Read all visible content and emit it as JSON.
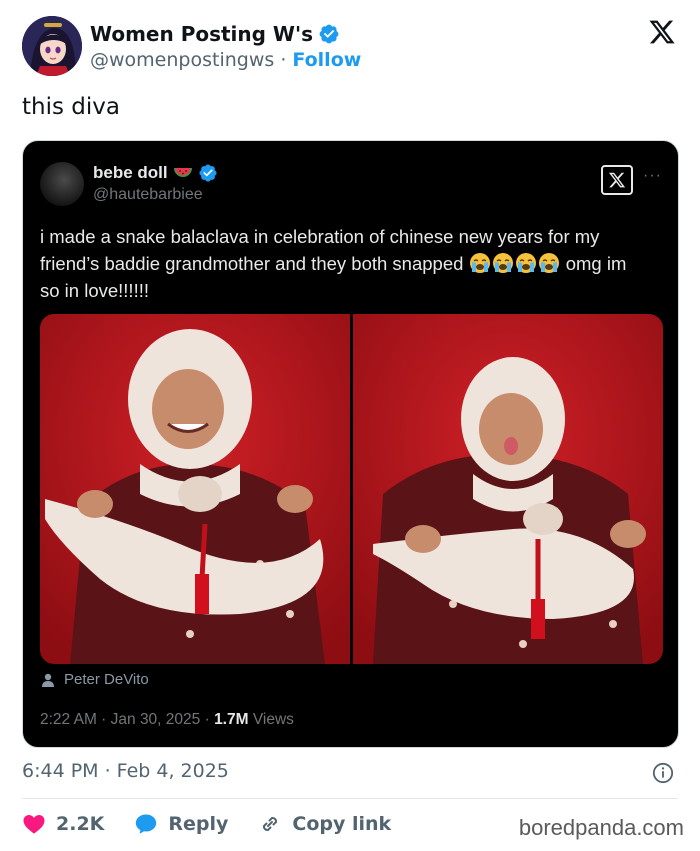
{
  "author": {
    "display_name": "Women Posting W's",
    "handle": "@womenpostingws",
    "separator": "·",
    "follow_label": "Follow"
  },
  "tweet": {
    "text": "this diva",
    "timestamp": "6:44 PM · Feb 4, 2025"
  },
  "quoted": {
    "display_name": "bebe doll",
    "handle": "@hautebarbiee",
    "more_label": "···",
    "text_main": "i made a snake balaclava in celebration of chinese new years for my friend’s baddie grandmother and they both snapped",
    "text_after_emoji": "omg im so in love!!!!!!",
    "photo_credit": "Peter DeVito",
    "time": "2:22 AM · Jan 30, 2025 · ",
    "views_count": "1.7M",
    "views_label": " Views"
  },
  "actions": {
    "like_count": "2.2K",
    "reply_label": "Reply",
    "copy_label": "Copy link"
  },
  "watermark": "boredpanda.com",
  "colors": {
    "verified": "#1d9bf0",
    "like": "#f91880",
    "reply": "#1d9bf0",
    "photo_bg": "#b3141a"
  },
  "icons": [
    "verified-badge-icon",
    "x-logo-icon",
    "watermelon-emoji-icon",
    "crying-emoji-icon",
    "person-icon",
    "info-icon",
    "heart-icon",
    "reply-bubble-icon",
    "link-icon"
  ]
}
